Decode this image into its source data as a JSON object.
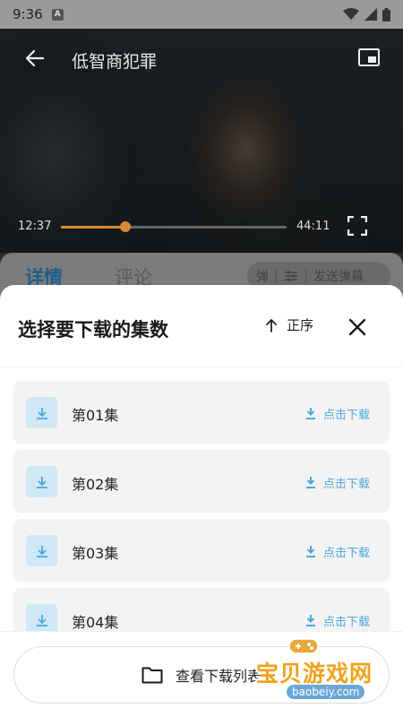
{
  "status_bar": {
    "time": "9:36",
    "badge": "A"
  },
  "player": {
    "title": "低智商犯罪",
    "current_time": "12:37",
    "total_time": "44:11",
    "progress": 0.286,
    "accent": "#d98a35"
  },
  "tabs": {
    "detail": "详情",
    "comment": "评论",
    "danmaku_toggle": "弹",
    "danmaku_send": "发送弹幕"
  },
  "sheet": {
    "title": "选择要下载的集数",
    "sort_label": "正序",
    "episodes": [
      {
        "label": "第01集",
        "action": "点击下载"
      },
      {
        "label": "第02集",
        "action": "点击下载"
      },
      {
        "label": "第03集",
        "action": "点击下载"
      },
      {
        "label": "第04集",
        "action": "点击下载"
      }
    ],
    "view_list_label": "查看下载列表"
  },
  "watermark": {
    "text": "宝贝游戏网",
    "url": "baobeiy.com"
  },
  "colors": {
    "link": "#4aa8dd",
    "icon_bg": "#cfe8f6",
    "tab_active": "#1f5f8a"
  }
}
